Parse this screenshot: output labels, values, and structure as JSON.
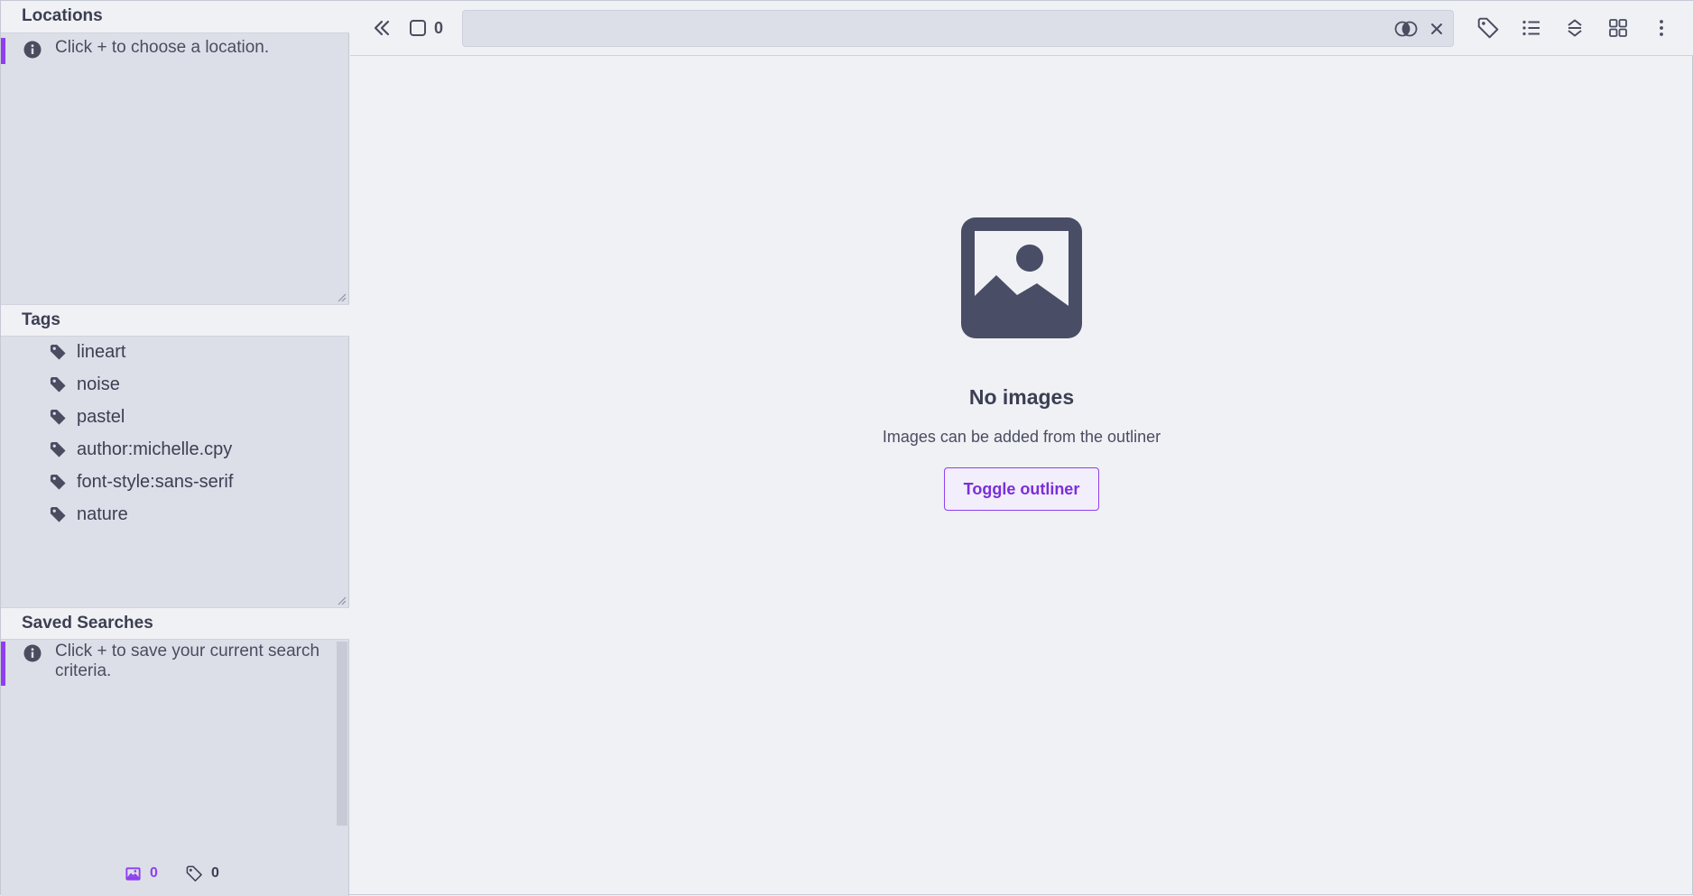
{
  "sidebar": {
    "locations": {
      "title": "Locations",
      "empty_message": "Click + to choose a location."
    },
    "tags": {
      "title": "Tags",
      "items": [
        {
          "label": "lineart"
        },
        {
          "label": "noise"
        },
        {
          "label": "pastel"
        },
        {
          "label": "author:michelle.cpy"
        },
        {
          "label": "font-style:sans-serif"
        },
        {
          "label": "nature"
        }
      ]
    },
    "saved_searches": {
      "title": "Saved Searches",
      "empty_message": "Click + to save your current search criteria."
    },
    "footer": {
      "image_count": "0",
      "tag_count": "0"
    }
  },
  "toolbar": {
    "selected_count": "0",
    "search": {
      "value": "",
      "placeholder": ""
    },
    "icons": [
      "chevrons-left-icon",
      "checkbox-icon",
      "toggle-icon",
      "close-icon",
      "tag-icon",
      "list-icon",
      "sort-icon",
      "grid-icon",
      "more-vertical-icon"
    ]
  },
  "main": {
    "empty_title": "No images",
    "empty_subtitle": "Images can be added from the outliner",
    "toggle_button_label": "Toggle outliner"
  },
  "colors": {
    "accent": "#8f3ff0",
    "sidebar_bg": "#dcdfe8",
    "main_bg": "#eff1f5",
    "text": "#3c3f52",
    "icon_dark": "#4a4d66"
  }
}
